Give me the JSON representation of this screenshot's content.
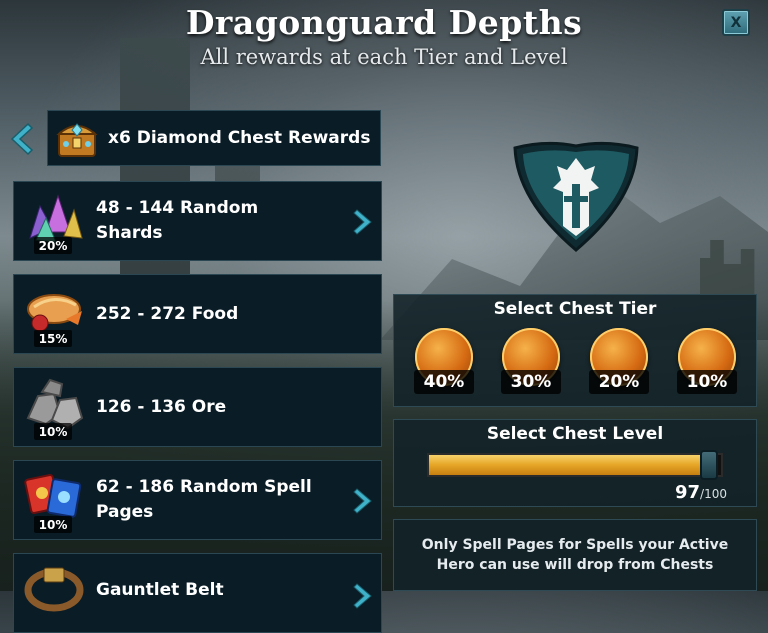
{
  "window": {
    "title": "Dragonguard Depths",
    "subtitle": "All rewards at each Tier and Level",
    "close_label": "X"
  },
  "chest_header": {
    "label": "x6 Diamond Chest Rewards",
    "icon": "diamond-chest-icon"
  },
  "rewards": [
    {
      "label": "48 - 144 Random Shards",
      "chance": "20%",
      "icon": "shards-icon",
      "has_details": true
    },
    {
      "label": "252 - 272 Food",
      "chance": "15%",
      "icon": "food-icon",
      "has_details": false
    },
    {
      "label": "126 - 136 Ore",
      "chance": "10%",
      "icon": "ore-icon",
      "has_details": false
    },
    {
      "label": "62 - 186 Random Spell Pages",
      "chance": "10%",
      "icon": "spell-pages-icon",
      "has_details": true
    },
    {
      "label": "Gauntlet Belt",
      "chance": "",
      "icon": "belt-icon",
      "has_details": true
    }
  ],
  "emblem": {
    "icon": "dragonguard-shield-icon"
  },
  "chest_tier": {
    "title": "Select Chest Tier",
    "tiers": [
      {
        "name": "wooden-chest",
        "chance": "40%"
      },
      {
        "name": "sapphire-chest",
        "chance": "30%"
      },
      {
        "name": "ruby-chest",
        "chance": "20%"
      },
      {
        "name": "diamond-chest",
        "chance": "10%",
        "selected": true
      }
    ]
  },
  "chest_level": {
    "title": "Select Chest Level",
    "value": "97",
    "max": "/100",
    "fraction": 0.97
  },
  "note": "Only Spell Pages for Spells your Active Hero can use will drop from Chests",
  "colors": {
    "panel": "#0a1c26",
    "accent": "#2e9fb8",
    "slider_fill": "#e6a626",
    "emblem": "#1e5a62"
  }
}
